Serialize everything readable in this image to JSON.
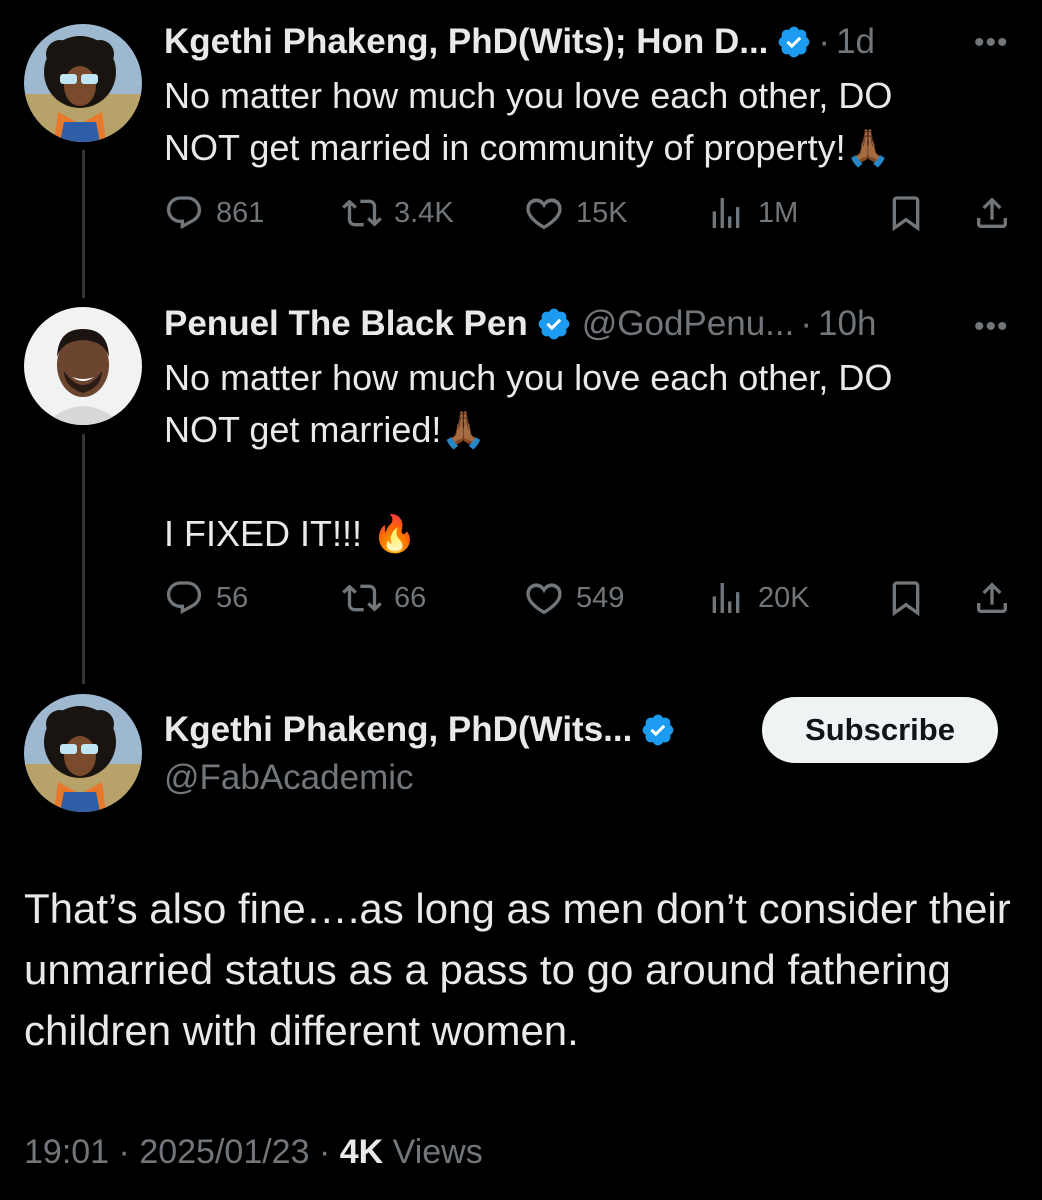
{
  "tweet1": {
    "name": "Kgethi Phakeng, PhD(Wits); Hon D...",
    "time": "1d",
    "text": "No matter how much you love each other, DO\nNOT get married in community of property!🙏🏾",
    "replies": "861",
    "retweets": "3.4K",
    "likes": "15K",
    "views": "1M"
  },
  "tweet2": {
    "name": "Penuel The Black Pen",
    "handle": "@GodPenu...",
    "time": "10h",
    "text": "No matter how much you love each other, DO\nNOT get married!🙏🏾\n\nI FIXED IT!!! 🔥",
    "replies": "56",
    "retweets": "66",
    "likes": "549",
    "views": "20K"
  },
  "main": {
    "name": "Kgethi Phakeng, PhD(Wits...",
    "handle": "@FabAcademic",
    "subscribe_label": "Subscribe",
    "text": "That’s also fine….as long as men don’t consider their unmarried status as a pass to go around fathering children with different women.",
    "time": "19:01",
    "date": "2025/01/23",
    "views_count": "4K",
    "views_label": "Views"
  },
  "separator": "·",
  "more_label": "•••",
  "colors": {
    "background": "#000000",
    "text": "#e7e9ea",
    "muted": "#71767b",
    "verified": "#1d9bf0"
  }
}
